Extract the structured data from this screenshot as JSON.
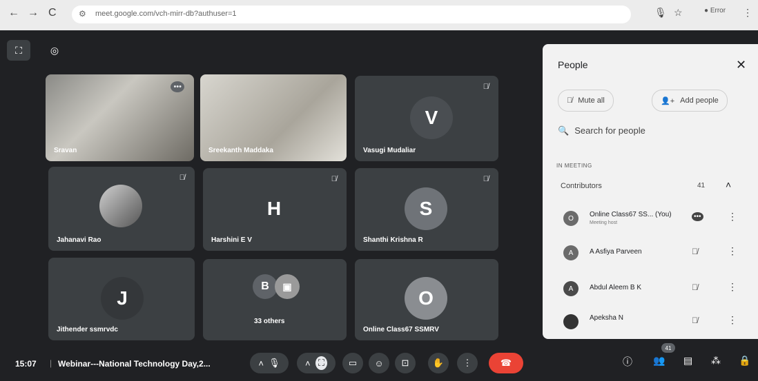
{
  "browser": {
    "url": "meet.google.com/vch-mirr-db?authuser=1",
    "profile_label": "Error"
  },
  "tiles": [
    {
      "name": "Sravan"
    },
    {
      "name": "Sreekanth Maddaka"
    },
    {
      "name": "Vasugi Mudaliar",
      "initial": "V"
    },
    {
      "name": "Jahanavi Rao"
    },
    {
      "name": "Harshini E V",
      "initial": "H"
    },
    {
      "name": "Shanthi Krishna R",
      "initial": "S"
    },
    {
      "name": "Jithender ssmrvdc",
      "initial": "J"
    },
    {
      "name": "33 others",
      "initial": "B"
    },
    {
      "name": "Online Class67 SSMRV",
      "initial": "O"
    }
  ],
  "people_panel": {
    "title": "People",
    "mute_all": "Mute all",
    "add_people": "Add people",
    "search_placeholder": "Search for people",
    "section_label": "IN MEETING",
    "contributors_label": "Contributors",
    "contributors_count": "41",
    "people": [
      {
        "initial": "O",
        "name": "Online Class67 SS... (You)",
        "sub": "Meeting host"
      },
      {
        "initial": "A",
        "name": "A Asfiya Parveen"
      },
      {
        "initial": "A",
        "name": "Abdul Aleem B K"
      },
      {
        "initial": "A",
        "name": "Apeksha N"
      }
    ]
  },
  "bottom_bar": {
    "time": "15:07",
    "meeting_title": "Webinar---National Technology Day,2...",
    "participants_badge": "41"
  }
}
